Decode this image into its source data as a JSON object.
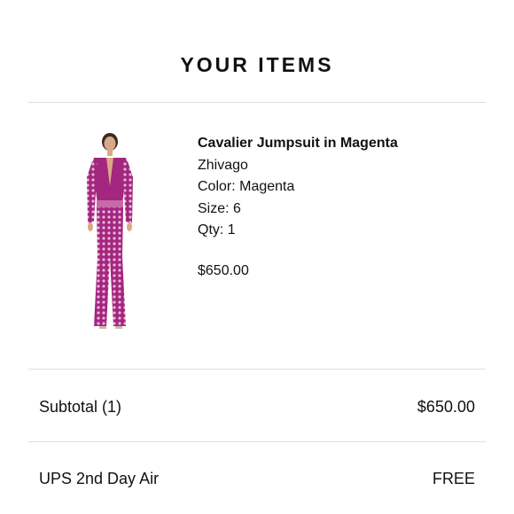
{
  "header": {
    "title": "YOUR ITEMS"
  },
  "item": {
    "name": "Cavalier Jumpsuit in Magenta",
    "brand": "Zhivago",
    "color": "Color: Magenta",
    "size": "Size: 6",
    "qty": "Qty: 1",
    "price": "$650.00",
    "image_icon": "product-photo-jumpsuit",
    "image_color": "#a3267f"
  },
  "summary": {
    "subtotal_label": "Subtotal (1)",
    "subtotal_value": "$650.00",
    "shipping_label": "UPS 2nd Day Air",
    "shipping_value": "FREE"
  }
}
